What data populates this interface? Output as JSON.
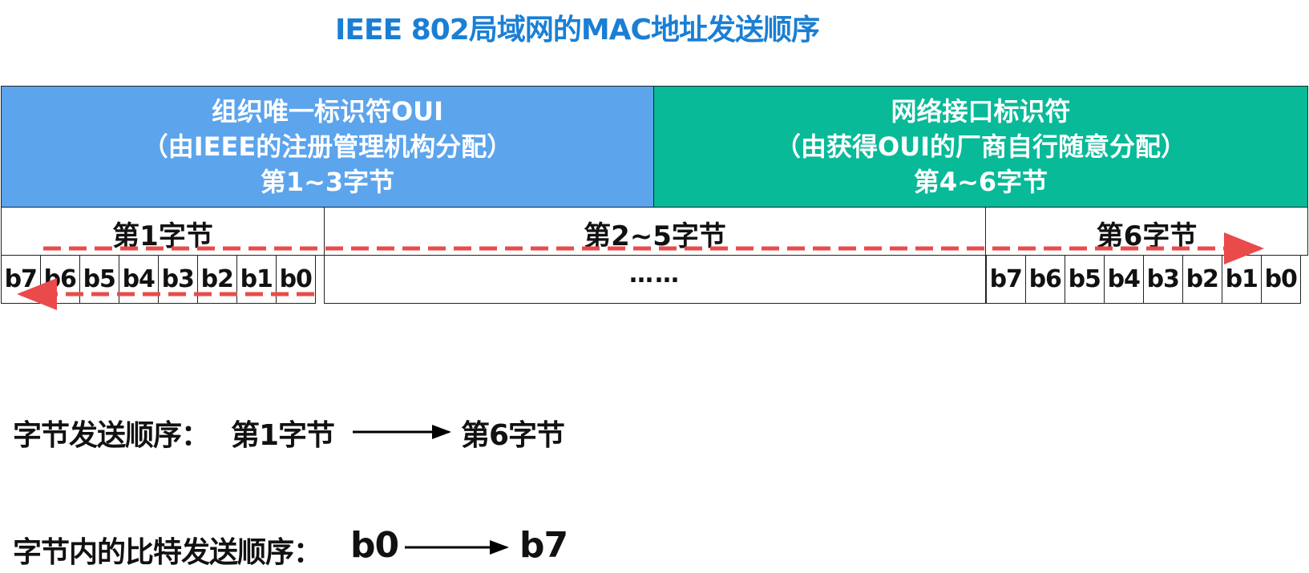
{
  "title": "IEEE 802局域网的MAC地址发送顺序",
  "oui_box": {
    "line1": "组织唯一标识符OUI",
    "line2": "（由IEEE的注册管理机构分配）",
    "line3": "第1~3字节"
  },
  "nic_box": {
    "line1": "网络接口标识符",
    "line2": "（由获得OUI的厂商自行随意分配）",
    "line3": "第4~6字节"
  },
  "byte_labels": {
    "byte1": "第1字节",
    "byte2_5": "第2~5字节",
    "byte6": "第6字节"
  },
  "bits": [
    "b7",
    "b6",
    "b5",
    "b4",
    "b3",
    "b2",
    "b1",
    "b0"
  ],
  "ellipsis": "……",
  "byte_order": {
    "label": "字节发送顺序：",
    "from": "第1字节",
    "to": "第6字节"
  },
  "bit_order": {
    "label": "字节内的比特发送顺序：",
    "from": "b0",
    "to": "b7"
  },
  "colors": {
    "title": "#1a7fd4",
    "oui_fill": "#5ca4ec",
    "nic_fill": "#08ba98",
    "arrow_dashed": "#ea4a4a",
    "arrow_solid": "#000000"
  }
}
